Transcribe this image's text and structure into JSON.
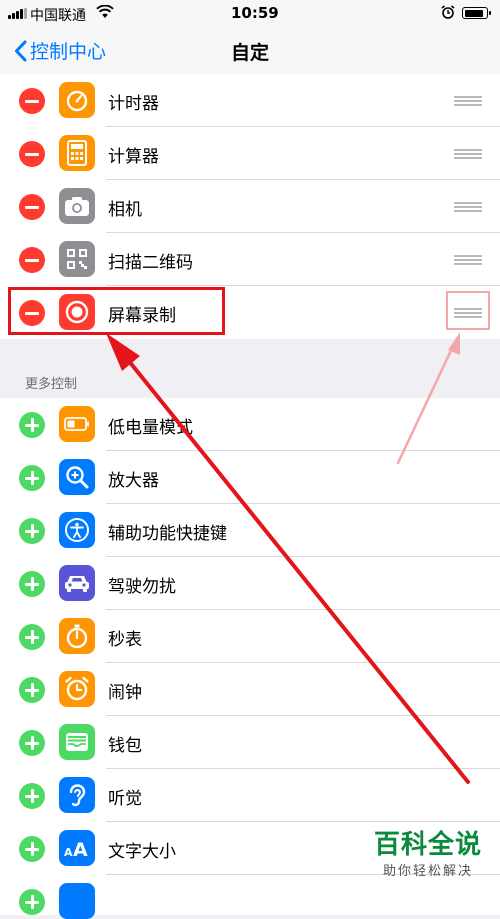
{
  "status_bar": {
    "carrier": "中国联通",
    "time": "10:59",
    "battery_level": 0.9
  },
  "nav": {
    "back_label": "控制中心",
    "title": "自定"
  },
  "included": [
    {
      "label": "计时器",
      "icon": "timer-icon",
      "color": "#ff9500"
    },
    {
      "label": "计算器",
      "icon": "calculator-icon",
      "color": "#ff9500"
    },
    {
      "label": "相机",
      "icon": "camera-icon",
      "color": "#8e8e93"
    },
    {
      "label": "扫描二维码",
      "icon": "qr-code-icon",
      "color": "#8e8e93"
    },
    {
      "label": "屏幕录制",
      "icon": "screen-record-icon",
      "color": "#ff3b30"
    }
  ],
  "more_section": {
    "header": "更多控制"
  },
  "more": [
    {
      "label": "低电量模式",
      "icon": "low-power-icon",
      "color": "#ff9500"
    },
    {
      "label": "放大器",
      "icon": "magnifier-icon",
      "color": "#007aff"
    },
    {
      "label": "辅助功能快捷键",
      "icon": "accessibility-icon",
      "color": "#007aff"
    },
    {
      "label": "驾驶勿扰",
      "icon": "car-icon",
      "color": "#5856d6"
    },
    {
      "label": "秒表",
      "icon": "stopwatch-icon",
      "color": "#ff9500"
    },
    {
      "label": "闹钟",
      "icon": "alarm-icon",
      "color": "#ff9500"
    },
    {
      "label": "钱包",
      "icon": "wallet-icon",
      "color": "#4cd964"
    },
    {
      "label": "听觉",
      "icon": "ear-icon",
      "color": "#007aff"
    },
    {
      "label": "文字大小",
      "icon": "text-size-icon",
      "color": "#007aff"
    }
  ],
  "watermark": {
    "title": "百科全说",
    "subtitle": "助你轻松解决"
  },
  "colors": {
    "accent": "#007aff",
    "annotation_red": "#e5141b",
    "annotation_pink": "#f4a7aa",
    "watermark_green": "#0a8a3a"
  }
}
